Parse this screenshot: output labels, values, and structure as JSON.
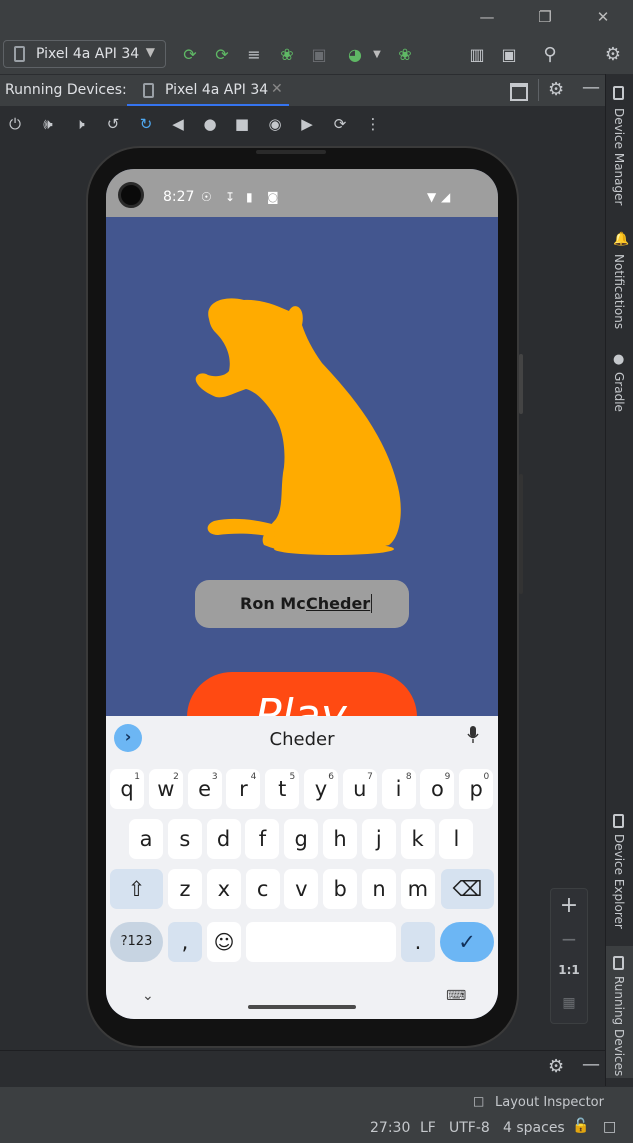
{
  "window": {
    "minimize": "—",
    "restore": "❐",
    "close": "✕"
  },
  "toolbar": {
    "device_selector": "Pixel 4a API 34",
    "icons": [
      "rerun-icon",
      "apply-changes-icon",
      "apply-code-changes-icon",
      "debug-icon",
      "profile-icon",
      "attach-debugger-icon",
      "stop-icon",
      "device-manager-icon",
      "sync-icon",
      "search-icon",
      "update-icon"
    ]
  },
  "tabs": {
    "label": "Running Devices:",
    "active_tab": "Pixel 4a API 34",
    "close": "✕"
  },
  "right_tools": [
    "Device Manager",
    "Notifications",
    "Gradle",
    "Device Explorer",
    "Running Devices"
  ],
  "zoom": {
    "plus": "+",
    "minus": "−",
    "one_to_one": "1:1"
  },
  "status_bar": {
    "layout_inspector": "Layout Inspector",
    "position": "27:30",
    "line_ending": "LF",
    "encoding": "UTF-8",
    "indent": "4 spaces"
  },
  "phone": {
    "time": "8:27",
    "name_field": {
      "prefix": "Ron Mc ",
      "composing": "Cheder"
    },
    "play_button": "Play",
    "keyboard": {
      "suggestion": "Cheder",
      "row1": [
        "q",
        "w",
        "e",
        "r",
        "t",
        "y",
        "u",
        "i",
        "o",
        "p"
      ],
      "row1_hints": [
        "1",
        "2",
        "3",
        "4",
        "5",
        "6",
        "7",
        "8",
        "9",
        "0"
      ],
      "row2": [
        "a",
        "s",
        "d",
        "f",
        "g",
        "h",
        "j",
        "k",
        "l"
      ],
      "row3": [
        "z",
        "x",
        "c",
        "v",
        "b",
        "n",
        "m"
      ],
      "symbols_key": "?123",
      "comma": ",",
      "period": "."
    }
  },
  "colors": {
    "app_background": "#43568f",
    "mouse": "#ffab00",
    "play": "#ff4a12",
    "enter_key": "#6cb6f4"
  }
}
